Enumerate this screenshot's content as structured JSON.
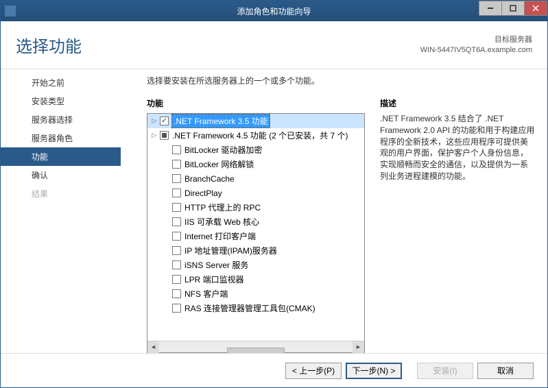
{
  "titlebar": {
    "title": "添加角色和功能向导"
  },
  "header": {
    "title": "选择功能",
    "target_label": "目标服务器",
    "target_value": "WIN-5447IV5QT6A.example.com"
  },
  "nav": {
    "items": [
      {
        "label": "开始之前",
        "state": "normal"
      },
      {
        "label": "安装类型",
        "state": "normal"
      },
      {
        "label": "服务器选择",
        "state": "normal"
      },
      {
        "label": "服务器角色",
        "state": "normal"
      },
      {
        "label": "功能",
        "state": "selected"
      },
      {
        "label": "确认",
        "state": "normal"
      },
      {
        "label": "结果",
        "state": "disabled"
      }
    ]
  },
  "main": {
    "instruction": "选择要安装在所选服务器上的一个或多个功能。",
    "features_label": "功能",
    "description_label": "描述",
    "features": [
      {
        "label": ".NET Framework 3.5 功能",
        "expandable": true,
        "checked": true,
        "selected": true
      },
      {
        "label": ".NET Framework 4.5 功能 (2 个已安装，共 7 个)",
        "expandable": true,
        "mixed": true
      },
      {
        "label": "BitLocker 驱动器加密",
        "indent": 1
      },
      {
        "label": "BitLocker 网络解锁",
        "indent": 1
      },
      {
        "label": "BranchCache",
        "indent": 1
      },
      {
        "label": "DirectPlay",
        "indent": 1
      },
      {
        "label": "HTTP 代理上的 RPC",
        "indent": 1
      },
      {
        "label": "IIS 可承载 Web 核心",
        "indent": 1
      },
      {
        "label": "Internet 打印客户端",
        "indent": 1
      },
      {
        "label": "IP 地址管理(IPAM)服务器",
        "indent": 1
      },
      {
        "label": "iSNS Server 服务",
        "indent": 1
      },
      {
        "label": "LPR 端口监视器",
        "indent": 1
      },
      {
        "label": "NFS 客户端",
        "indent": 1
      },
      {
        "label": "RAS 连接管理器管理工具包(CMAK)",
        "indent": 1
      }
    ],
    "description_text": ".NET Framework 3.5 结合了 .NET Framework 2.0 API 的功能和用于构建应用程序的全新技术，这些应用程序可提供美观的用户界面，保护客户个人身份信息，实现顺畅而安全的通信，以及提供为一系列业务进程建模的功能。"
  },
  "footer": {
    "prev": "< 上一步(P)",
    "next": "下一步(N) >",
    "install": "安装(I)",
    "cancel": "取消"
  }
}
